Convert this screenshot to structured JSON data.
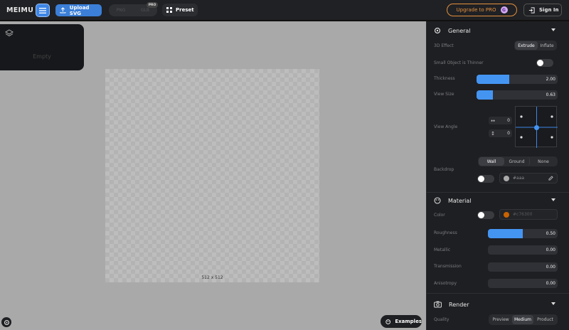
{
  "topbar": {
    "brand": "MEIMU",
    "upload_label": "Upload SVG",
    "formats": [
      "PNG",
      "GLB"
    ],
    "pro_badge": "PRO",
    "preset_label": "Preset",
    "upgrade_label": "Upgrade to PRO",
    "signin_label": "Sign In"
  },
  "layers": {
    "empty_label": "Empty"
  },
  "canvas": {
    "size_label": "512 x 512"
  },
  "examples_label": "Examples",
  "general": {
    "title": "General",
    "effect_label": "3D Effect",
    "effect_options": [
      "Extrude",
      "Inflate"
    ],
    "effect_selected": "Extrude",
    "thinner_label": "Small Object is Thinner",
    "thinner_on": false,
    "thickness_label": "Thickness",
    "thickness_value": "2.00",
    "thickness_fraction": 0.4,
    "viewsize_label": "View Size",
    "viewsize_value": "0.63",
    "viewsize_fraction": 0.2,
    "viewangle_label": "View Angle",
    "angle_h": "0",
    "angle_v": "0",
    "backdrop_label": "Backdrop",
    "backdrop_options": [
      "Wall",
      "Ground",
      "None"
    ],
    "backdrop_selected": "Wall",
    "backdrop_on": false,
    "backdrop_color": "#aaa"
  },
  "material": {
    "title": "Material",
    "color_label": "Color",
    "color_on": false,
    "color_value": "#c76300",
    "roughness_label": "Roughness",
    "roughness_value": "0.50",
    "roughness_fraction": 0.5,
    "metallic_label": "Metallic",
    "metallic_value": "0.00",
    "transmission_label": "Transmission",
    "transmission_value": "0.00",
    "anisotropy_label": "Anisotropy",
    "anisotropy_value": "0.00"
  },
  "render": {
    "title": "Render",
    "quality_label": "Quality",
    "quality_options": [
      "Preview",
      "Medium",
      "Product"
    ],
    "quality_selected": "Medium"
  },
  "colors": {
    "accent": "#4495f2",
    "upgrade": "#e3903f",
    "panel": "#1e1f22"
  }
}
